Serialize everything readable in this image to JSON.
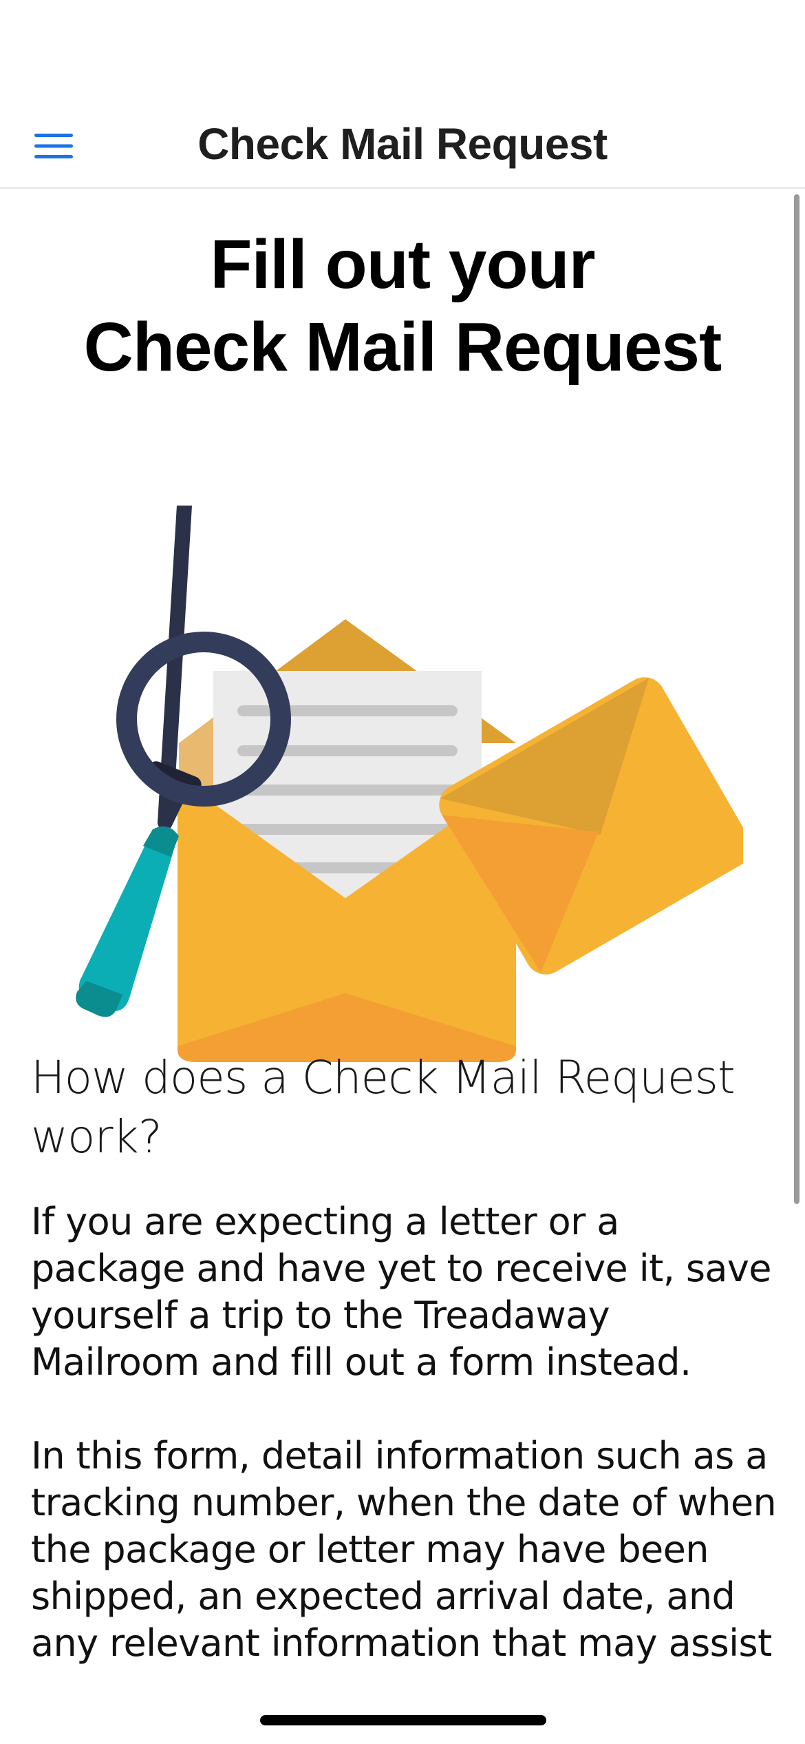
{
  "nav": {
    "title": "Check Mail Request",
    "menu_icon": "hamburger-menu-icon",
    "accent_color": "#1a73e8"
  },
  "hero": {
    "title_line_1": "Fill out your",
    "title_line_2": "Check Mail Request"
  },
  "illustration": {
    "icon": "mail-search-illustration"
  },
  "content": {
    "heading": "How does a Check Mail Request work?",
    "paragraph_1": "If you are expecting a letter or a package and have yet to receive it, save yourself a trip to the Treadaway Mailroom and fill out a form instead.",
    "paragraph_2": "In this form, detail information such as a tracking number, when the date of when the package or letter may have been shipped, an expected arrival date, and any relevant information that may assist your"
  }
}
